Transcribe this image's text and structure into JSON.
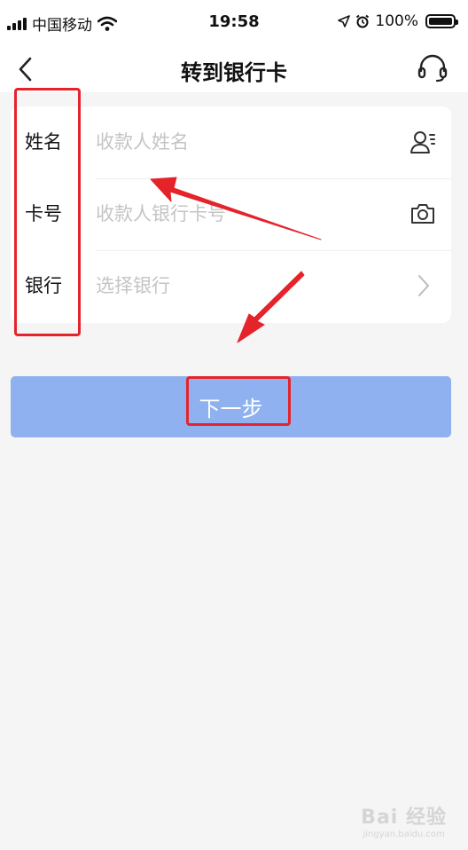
{
  "status_bar": {
    "carrier": "中国移动",
    "time": "19:58",
    "battery": "100%"
  },
  "nav": {
    "title": "转到银行卡",
    "back_icon": "chevron-left-icon",
    "service_icon": "headset-icon"
  },
  "form": {
    "rows": [
      {
        "label": "姓名",
        "placeholder": "收款人姓名",
        "icon": "contact-icon"
      },
      {
        "label": "卡号",
        "placeholder": "收款人银行卡号",
        "icon": "camera-icon"
      },
      {
        "label": "银行",
        "placeholder": "选择银行",
        "icon": "chevron-right-icon"
      }
    ]
  },
  "next_button": {
    "label": "下一步"
  },
  "colors": {
    "accent_button": "#8fb1f0",
    "annotation": "#e5232b",
    "background": "#f5f5f5"
  },
  "watermark": {
    "main": "Bai 经验",
    "sub": "jingyan.baidu.com"
  }
}
